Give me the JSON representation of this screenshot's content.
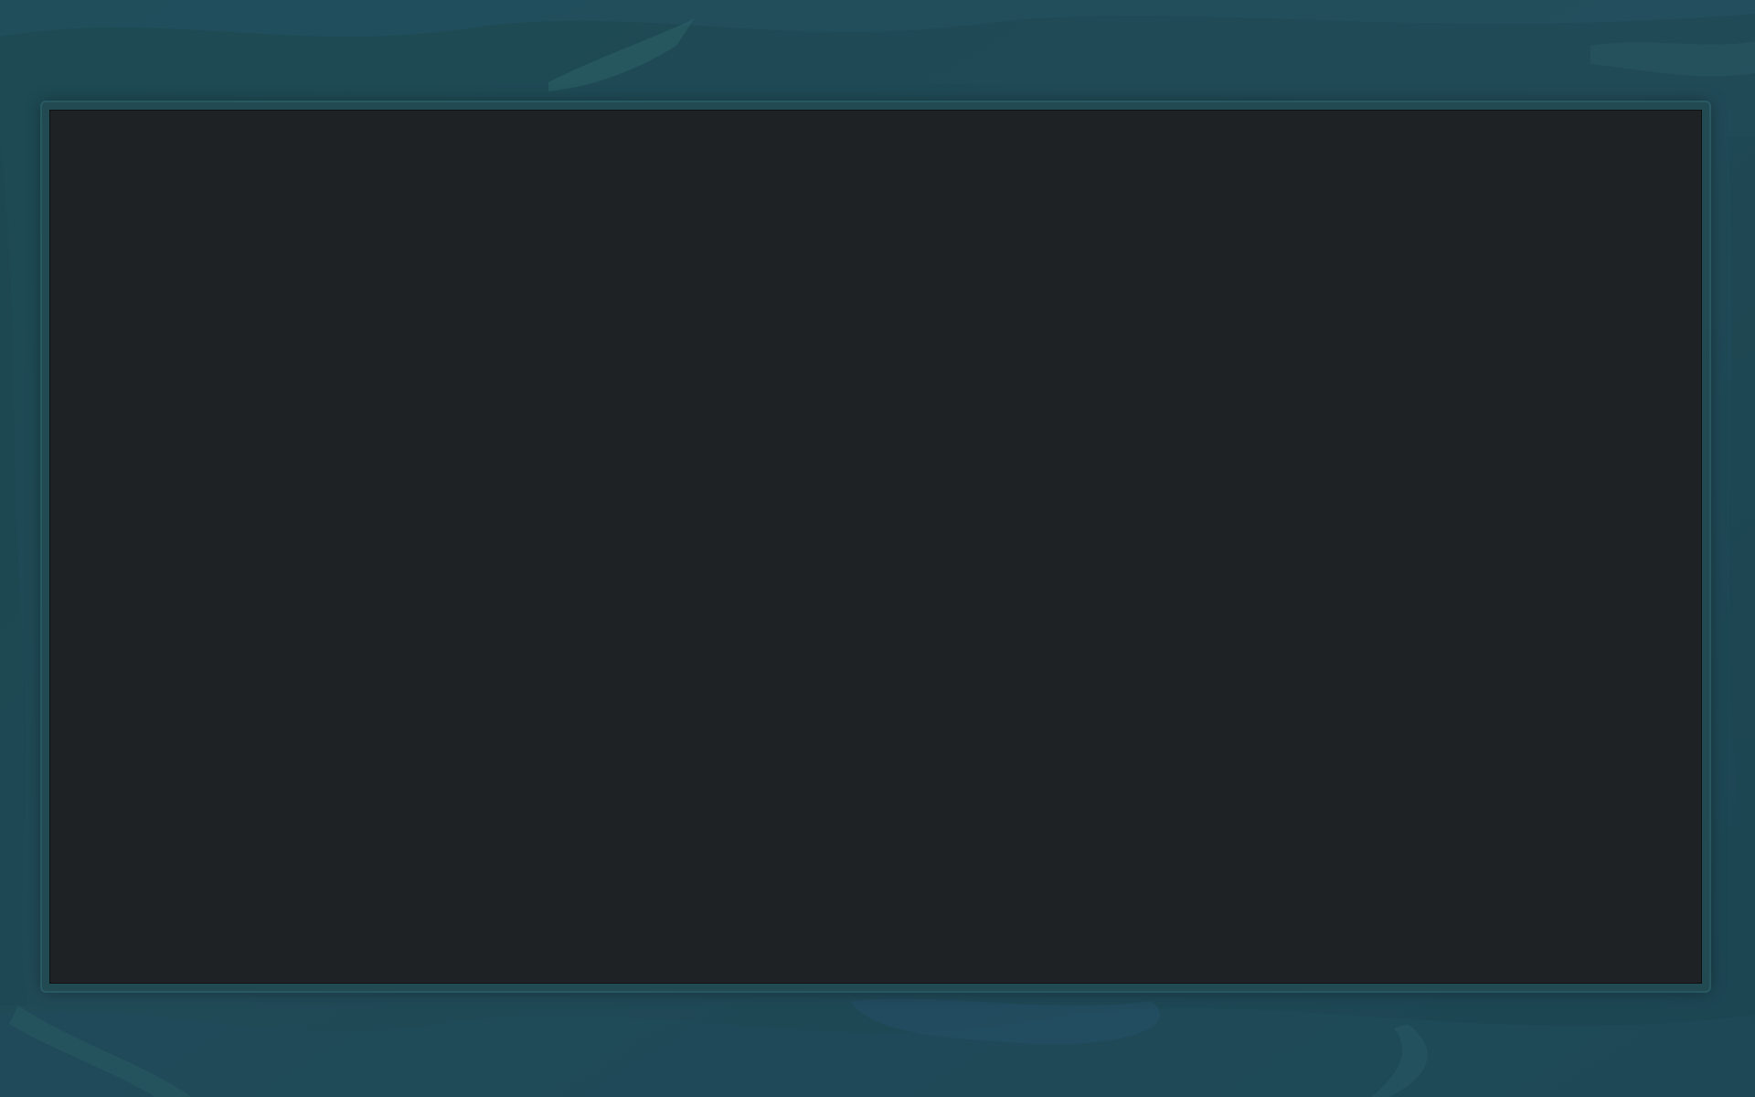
{
  "colors": {
    "background": "#1f4a55",
    "frame": "#224a53",
    "screen": "#1f2224"
  }
}
